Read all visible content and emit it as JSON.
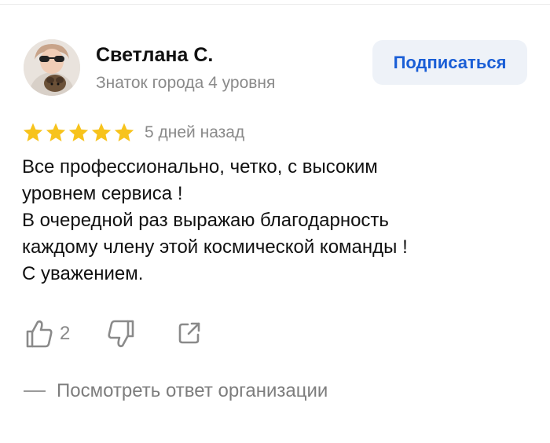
{
  "author": {
    "name": "Светлана С.",
    "rank": "Знаток города 4 уровня"
  },
  "subscribe_label": "Подписаться",
  "review": {
    "rating": 5,
    "max_rating": 5,
    "date": "5 дней назад",
    "lines": [
      "Все профессионально, четко, с высоким",
      "уровнем сервиса !",
      "В очередной раз выражаю благодарность",
      "каждому члену этой космической команды !",
      "С уважением."
    ]
  },
  "actions": {
    "like_count": "2"
  },
  "org_reply_label": "Посмотреть ответ организации",
  "colors": {
    "accent": "#1a5ed6",
    "star": "#f7c31c",
    "muted": "#8a8a8a",
    "button_bg": "#eef2f8"
  },
  "icons": [
    "thumbs-up-icon",
    "thumbs-down-icon",
    "share-icon",
    "star-icon"
  ]
}
